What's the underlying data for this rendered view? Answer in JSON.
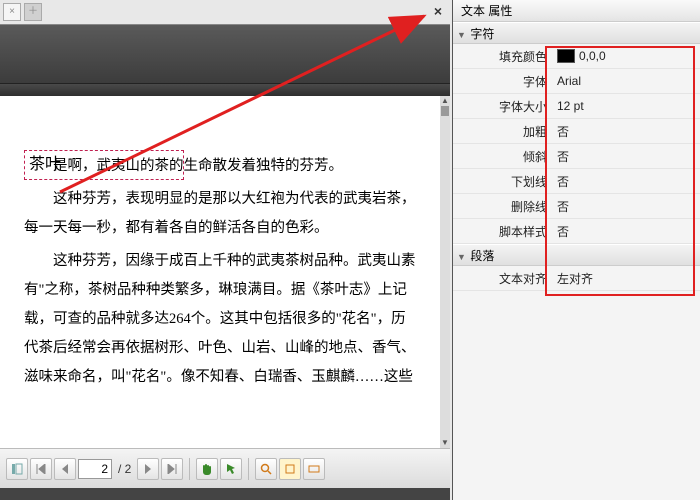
{
  "panel_title": "文本 属性",
  "sections": {
    "char": {
      "header": "字符",
      "rows": {
        "fill_color": {
          "label": "填充颜色",
          "value": "0,0,0"
        },
        "font": {
          "label": "字体",
          "value": "Arial"
        },
        "font_size": {
          "label": "字体大小",
          "value": "12 pt"
        },
        "bold": {
          "label": "加粗",
          "value": "否"
        },
        "italic": {
          "label": "倾斜",
          "value": "否"
        },
        "underline": {
          "label": "下划线",
          "value": "否"
        },
        "strike": {
          "label": "删除线",
          "value": "否"
        },
        "script": {
          "label": "脚本样式",
          "value": "否"
        }
      }
    },
    "para": {
      "header": "段落",
      "rows": {
        "align": {
          "label": "文本对齐",
          "value": "左对齐"
        }
      }
    }
  },
  "selection_text": "茶叶",
  "doc_paragraphs": [
    "是啊，武夷山的茶的生命散发着独特的芬芳。",
    "这种芬芳，表现明显的是那以大红袍为代表的武夷岩茶，每一天每一秒，都有着各自的鲜活各自的色彩。",
    "这种芬芳，因缘于成百上千种的武夷茶树品种。武夷山素有\"之称，茶树品种种类繁多，琳琅满目。据《茶叶志》上记载，可查的品种就多达264个。这其中包括很多的\"花名\"，历代茶后经常会再依据树形、叶色、山岩、山峰的地点、香气、滋味来命名，叫\"花名\"。像不知春、白瑞香、玉麒麟……这些"
  ],
  "nav": {
    "current_page": "2",
    "total_pages": "/ 2"
  }
}
